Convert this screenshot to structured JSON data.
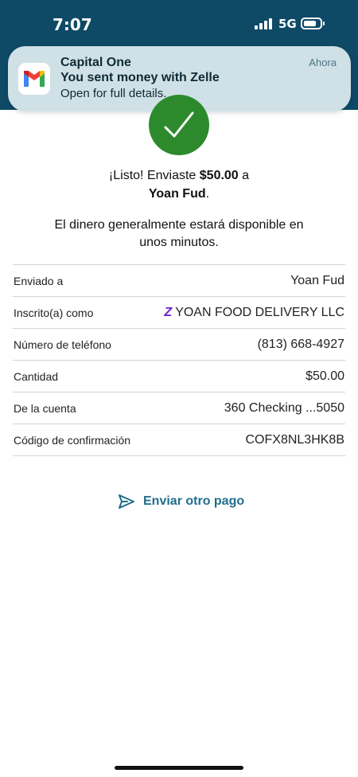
{
  "status_bar": {
    "time": "7:07",
    "network": "5G",
    "icons": [
      "signal-icon",
      "battery-icon"
    ]
  },
  "notification": {
    "app": "Capital One",
    "title": "You sent money with Zelle",
    "body": "Open for full details.",
    "time": "Ahora",
    "icon": "gmail-icon"
  },
  "confirmation": {
    "prefix": "¡Listo! Enviaste",
    "amount": "$50.00",
    "suffix": "a",
    "recipient": "Yoan Fud",
    "period": ".",
    "availability": "El dinero generalmente estará disponible en unos minutos."
  },
  "details": [
    {
      "label": "Enviado a",
      "value": "Yoan Fud"
    },
    {
      "label": "Inscrito(a) como",
      "value": "YOAN FOOD DELIVERY LLC",
      "badge": "Z"
    },
    {
      "label": "Número de teléfono",
      "value": "(813) 668-4927"
    },
    {
      "label": "Cantidad",
      "value": "$50.00"
    },
    {
      "label": "De la cuenta",
      "value": "360 Checking ...5050"
    },
    {
      "label": "Código de confirmación",
      "value": "COFX8NL3HK8B"
    }
  ],
  "actions": {
    "send_again": "Enviar otro pago"
  },
  "colors": {
    "header": "#0e4a66",
    "success": "#2c8a2c",
    "link": "#1f6e8c",
    "zelle": "#6d1ed4"
  }
}
